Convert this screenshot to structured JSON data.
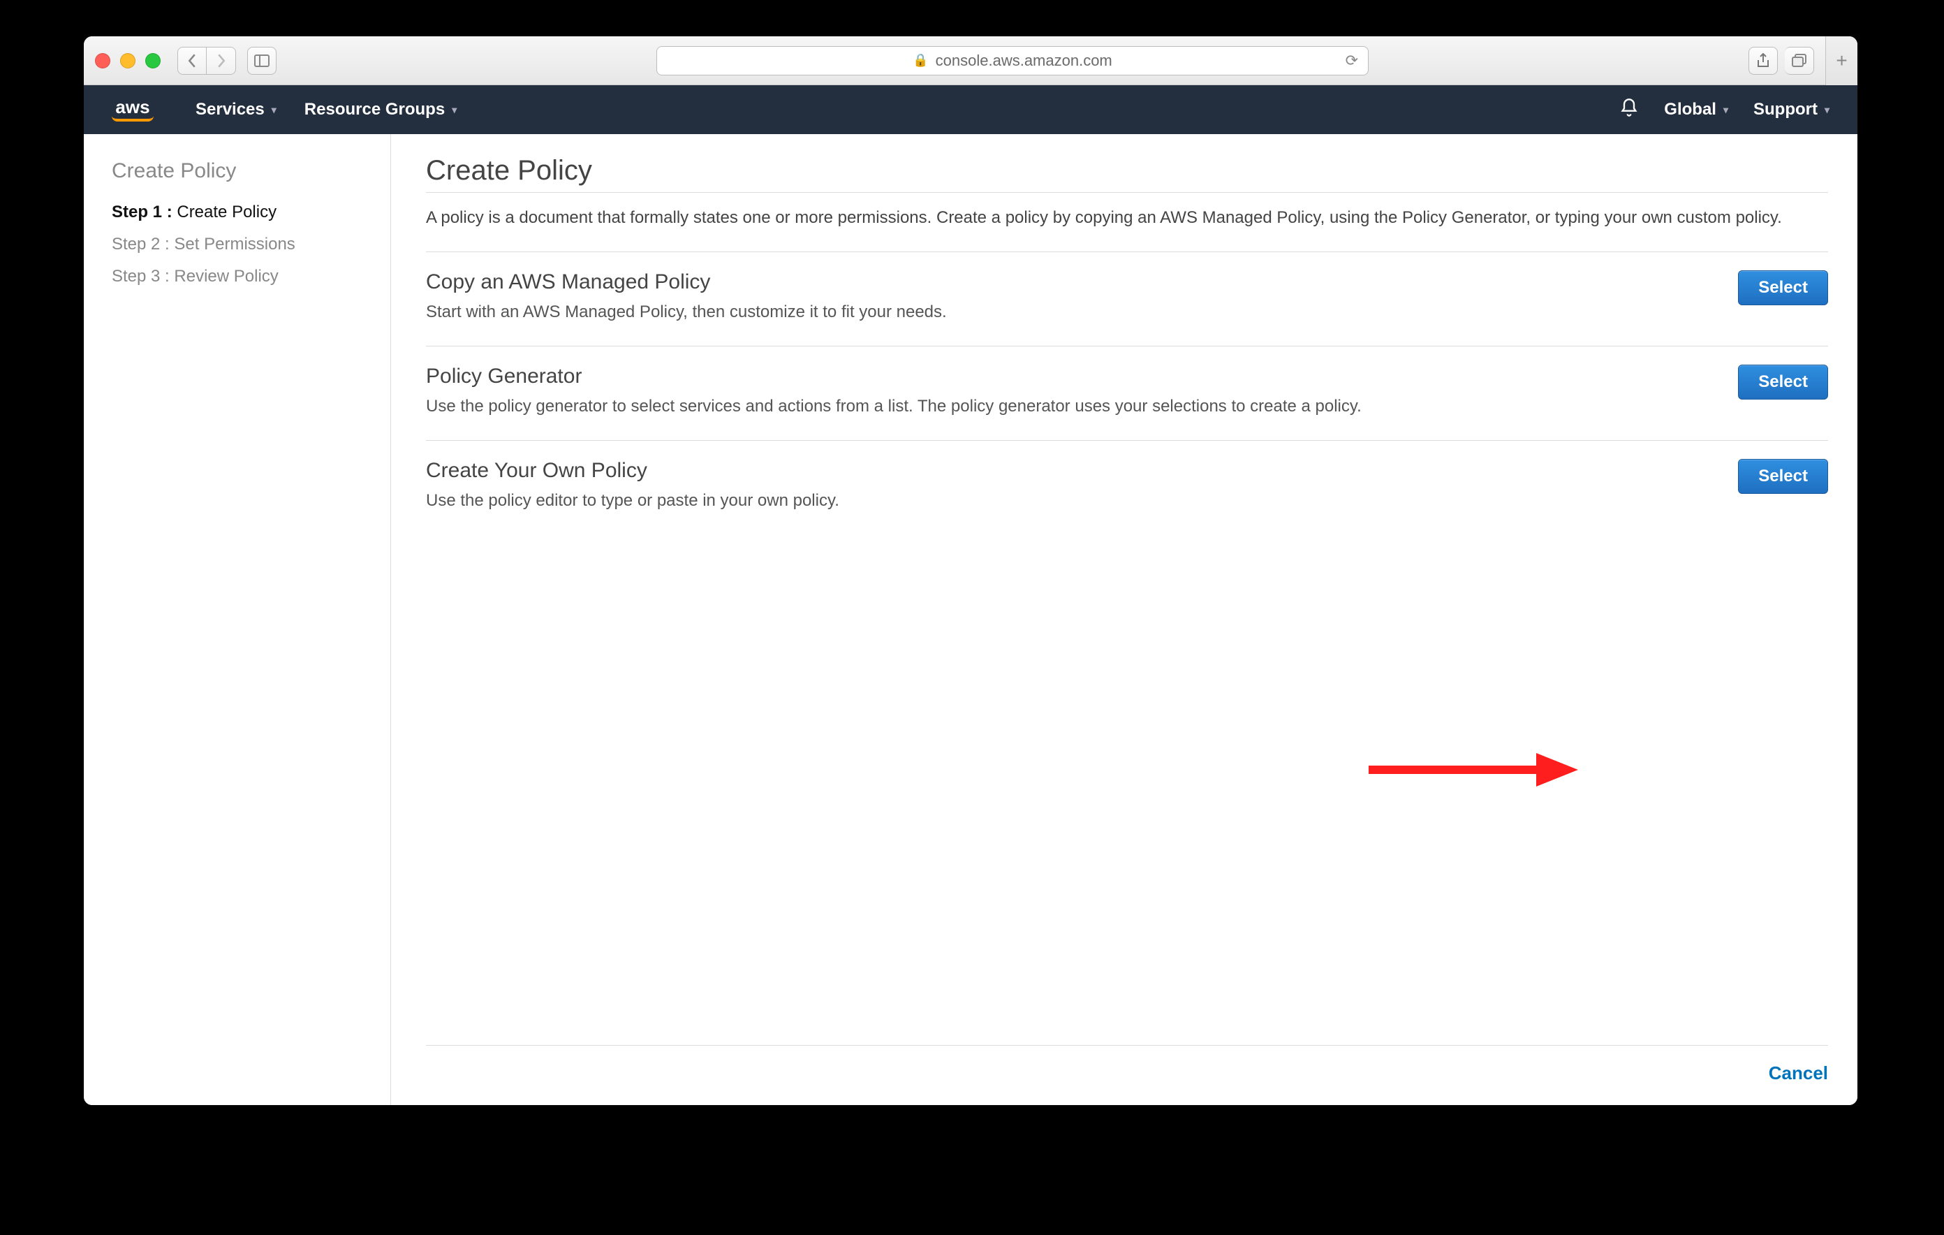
{
  "browser": {
    "url_display": "console.aws.amazon.com"
  },
  "nav": {
    "services": "Services",
    "resource_groups": "Resource Groups",
    "region": "Global",
    "support": "Support"
  },
  "sidebar": {
    "title": "Create Policy",
    "steps": [
      {
        "prefix": "Step 1 :",
        "label": "Create Policy",
        "active": true
      },
      {
        "prefix": "Step 2 :",
        "label": "Set Permissions",
        "active": false
      },
      {
        "prefix": "Step 3 :",
        "label": "Review Policy",
        "active": false
      }
    ]
  },
  "main": {
    "title": "Create Policy",
    "intro": "A policy is a document that formally states one or more permissions. Create a policy by copying an AWS Managed Policy, using the Policy Generator, or typing your own custom policy.",
    "options": [
      {
        "title": "Copy an AWS Managed Policy",
        "desc": "Start with an AWS Managed Policy, then customize it to fit your needs.",
        "button": "Select"
      },
      {
        "title": "Policy Generator",
        "desc": "Use the policy generator to select services and actions from a list. The policy generator uses your selections to create a policy.",
        "button": "Select"
      },
      {
        "title": "Create Your Own Policy",
        "desc": "Use the policy editor to type or paste in your own policy.",
        "button": "Select"
      }
    ],
    "cancel": "Cancel"
  }
}
